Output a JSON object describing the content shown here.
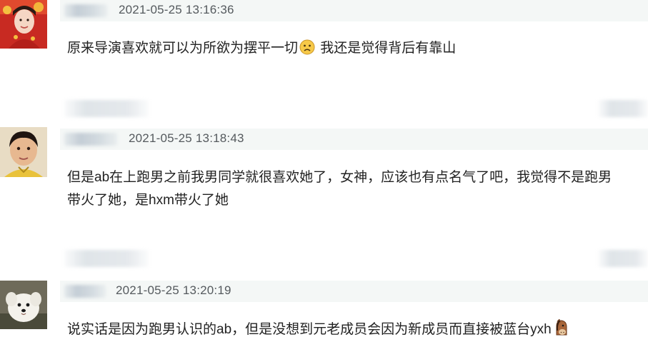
{
  "comments": [
    {
      "timestamp": "2021-05-25 13:16:36",
      "text_before_emoji": "原来导演喜欢就可以为所欲为摆平一切",
      "emoji": "sad-face-emoji",
      "text_after_emoji": " 我还是觉得背后有靠山",
      "avatar": "avatar-girl-red-costume"
    },
    {
      "timestamp": "2021-05-25 13:18:43",
      "text_line1": "但是ab在上跑男之前我男同学就很喜欢她了，女神，应该也有点名气了吧，我觉得不是跑男",
      "text_line2": "带火了她，是hxm带火了她",
      "avatar": "avatar-boy-yellow-shirt"
    },
    {
      "timestamp": "2021-05-25 13:20:19",
      "text_before_emoji": "说实话是因为跑男认识的ab，但是没想到元老成员会因为新成员而直接被蓝台yxh",
      "emoji": "horse-face-emoji",
      "avatar": "avatar-white-dog"
    }
  ],
  "colors": {
    "meta_bar": "#f4f7f6",
    "timestamp": "#555a5e",
    "text": "#222222"
  }
}
